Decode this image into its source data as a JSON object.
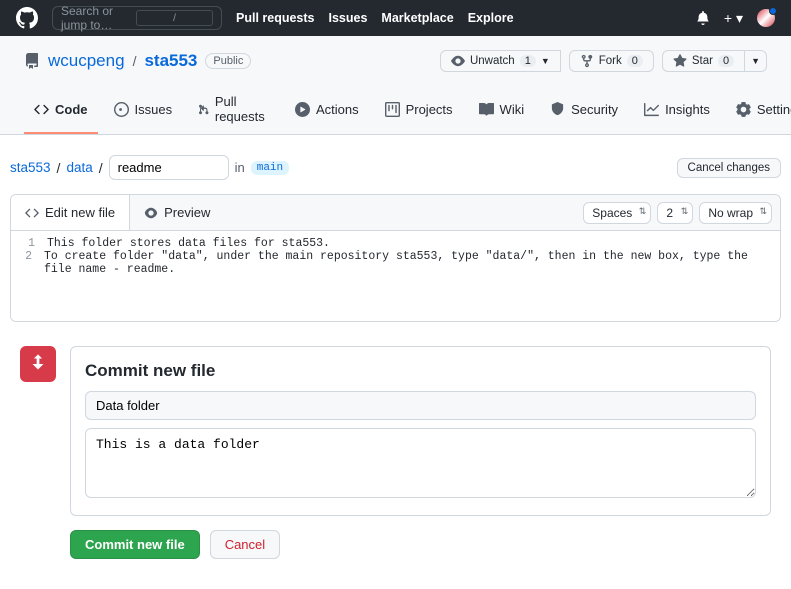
{
  "topbar": {
    "search_placeholder": "Search or jump to…",
    "nav": {
      "pulls": "Pull requests",
      "issues": "Issues",
      "marketplace": "Marketplace",
      "explore": "Explore"
    }
  },
  "repo": {
    "owner": "wcucpeng",
    "name": "sta553",
    "visibility": "Public",
    "actions": {
      "unwatch": {
        "label": "Unwatch",
        "count": "1"
      },
      "fork": {
        "label": "Fork",
        "count": "0"
      },
      "star": {
        "label": "Star",
        "count": "0"
      }
    }
  },
  "tabs": {
    "code": "Code",
    "issues": "Issues",
    "pulls": "Pull requests",
    "actions": "Actions",
    "projects": "Projects",
    "wiki": "Wiki",
    "security": "Security",
    "insights": "Insights",
    "settings": "Settings"
  },
  "breadcrumb": {
    "root": "sta553",
    "folder": "data",
    "filename": "readme",
    "in": "in",
    "branch": "main",
    "cancel": "Cancel changes"
  },
  "editor": {
    "edit_tab": "Edit new file",
    "preview_tab": "Preview",
    "opt_spaces": "Spaces",
    "opt_indent": "2",
    "opt_wrap": "No wrap",
    "lines": [
      "This folder stores data files for sta553.",
      "To create folder \"data\", under the main repository sta553, type \"data/\", then in the new box, type the file name - readme."
    ]
  },
  "commit": {
    "heading": "Commit new file",
    "summary": "Data folder",
    "description": "This is a data folder",
    "submit": "Commit new file",
    "cancel": "Cancel"
  }
}
